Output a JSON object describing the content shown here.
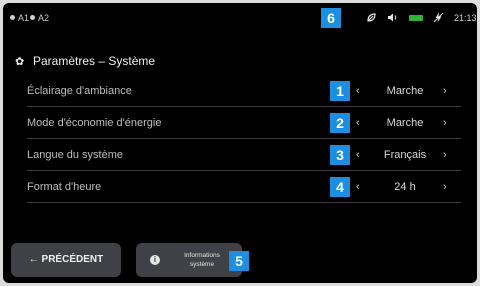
{
  "status_bar": {
    "radio_a1": "A1",
    "radio_a2": "A2",
    "badge": "6",
    "leaf_icon": "leaf-icon",
    "volume_icon": "volume-icon",
    "battery_icon": "battery-icon",
    "battery_color": "#2fb13a",
    "signal_icon": "no-signal-icon",
    "time": "21:13"
  },
  "page": {
    "title": "Paramètres – Système",
    "title_icon": "gear-icon"
  },
  "settings": [
    {
      "badge": "1",
      "label": "Éclairage d'ambiance",
      "value": "Marche",
      "prev": "‹",
      "next": "›"
    },
    {
      "badge": "2",
      "label": "Mode d'économie d'énergie",
      "value": "Marche",
      "prev": "‹",
      "next": "›"
    },
    {
      "badge": "3",
      "label": "Langue du système",
      "value": "Français",
      "prev": "‹",
      "next": "›"
    },
    {
      "badge": "4",
      "label": "Format d'heure",
      "value": "24 h",
      "prev": "‹",
      "next": "›"
    }
  ],
  "footer": {
    "prev_label": "← PRÉCÉDENT",
    "info_line1": "Informations",
    "info_line2": "système",
    "info_badge": "5"
  },
  "colors": {
    "accent_badge": "#1e8fe0",
    "background": "#000000",
    "button_bg": "#3f4147"
  }
}
